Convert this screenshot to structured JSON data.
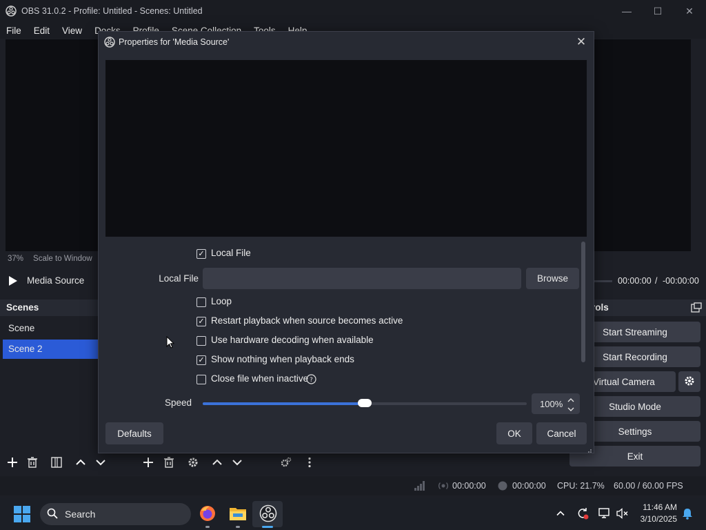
{
  "window": {
    "title": "OBS 31.0.2 - Profile: Untitled - Scenes: Untitled",
    "minimize": "—",
    "maximize": "☐",
    "close": "✕"
  },
  "menu": [
    "File",
    "Edit",
    "View",
    "Docks",
    "Profile",
    "Scene Collection",
    "Tools",
    "Help"
  ],
  "preview": {
    "zoom": "37%",
    "scale_mode": "Scale to Window"
  },
  "media": {
    "source_name": "Media Source",
    "time_current": "00:00:00",
    "separator": "/",
    "time_remaining": "-00:00:00"
  },
  "scenes": {
    "header": "Scenes",
    "items": [
      "Scene",
      "Scene 2"
    ],
    "selected_index": 1
  },
  "controls": {
    "header_fragment": "rols",
    "start_streaming": "Start Streaming",
    "start_recording": "Start Recording",
    "virtual_camera": "rt Virtual Camera",
    "studio_mode": "Studio Mode",
    "settings": "Settings",
    "exit": "Exit"
  },
  "statusbar": {
    "stream_time": "00:00:00",
    "record_time": "00:00:00",
    "cpu": "CPU: 21.7%",
    "fps": "60.00 / 60.00 FPS"
  },
  "dialog": {
    "title": "Properties for 'Media Source'",
    "close": "✕",
    "local_file_checkbox": {
      "label": "Local File",
      "checked": true
    },
    "local_file_label": "Local File",
    "local_file_value": "",
    "browse": "Browse",
    "loop": {
      "label": "Loop",
      "checked": false
    },
    "restart": {
      "label": "Restart playback when source becomes active",
      "checked": true
    },
    "hw_decode": {
      "label": "Use hardware decoding when available",
      "checked": false
    },
    "show_nothing": {
      "label": "Show nothing when playback ends",
      "checked": true
    },
    "close_inactive": {
      "label": "Close file when inactive",
      "checked": false
    },
    "speed_label": "Speed",
    "speed_value": "100%",
    "speed_fraction": 0.5,
    "defaults": "Defaults",
    "ok": "OK",
    "cancel": "Cancel"
  },
  "taskbar": {
    "search_placeholder": "Search",
    "time": "11:46 AM",
    "date": "3/10/2025"
  },
  "colors": {
    "accent": "#3b72d9",
    "selected_scene": "#2b5bd7",
    "panel_bg": "#1d1f26",
    "button_bg": "#3a3d48"
  }
}
